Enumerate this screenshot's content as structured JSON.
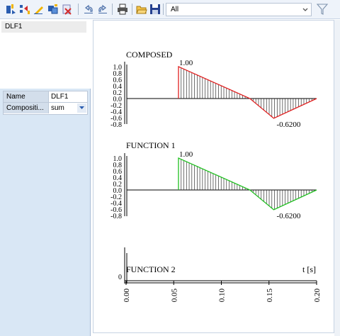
{
  "toolbar": {
    "buttons": [
      {
        "name": "new-function-icon"
      },
      {
        "name": "import-icon"
      },
      {
        "name": "edit-icon"
      },
      {
        "name": "duplicate-icon"
      },
      {
        "name": "delete-icon"
      },
      {
        "name": "undo-icon"
      },
      {
        "name": "redo-icon"
      },
      {
        "name": "print-icon"
      },
      {
        "name": "open-folder-icon"
      },
      {
        "name": "save-icon"
      }
    ],
    "filter": {
      "value": "All"
    },
    "filter_icon": "funnel-icon"
  },
  "left_panel": {
    "list_items": [
      "DLF1"
    ],
    "properties": [
      {
        "name": "Name",
        "value": "DLF1",
        "dropdown": false
      },
      {
        "name": "Compositi...",
        "value": "sum",
        "dropdown": true
      }
    ]
  },
  "colors": {
    "composed_line": "#e02020",
    "function1_line": "#20c020",
    "axis": "#000000"
  },
  "chart_data": [
    {
      "type": "line",
      "title": "COMPOSED",
      "x": [
        0.055,
        0.055,
        0.13,
        0.155,
        0.2
      ],
      "y": [
        0.0,
        1.0,
        0.0,
        -0.62,
        0.0
      ],
      "yticks": [
        "1.0",
        "0.8",
        "0.6",
        "0.4",
        "0.2",
        "0.0",
        "-0.2",
        "-0.4",
        "-0.6",
        "-0.8"
      ],
      "ylim": [
        -0.8,
        1.0
      ],
      "annotations": [
        "1.00",
        "-0.6200"
      ],
      "hatched": true
    },
    {
      "type": "line",
      "title": "FUNCTION 1",
      "x": [
        0.055,
        0.055,
        0.13,
        0.155,
        0.2
      ],
      "y": [
        0.0,
        1.0,
        0.0,
        -0.62,
        0.0
      ],
      "yticks": [
        "1.0",
        "0.8",
        "0.6",
        "0.4",
        "0.2",
        "0.0",
        "-0.2",
        "-0.4",
        "-0.6",
        "-0.8"
      ],
      "ylim": [
        -0.8,
        1.0
      ],
      "annotations": [
        "1.00",
        "-0.6200"
      ],
      "hatched": true
    },
    {
      "type": "line",
      "title": "FUNCTION 2",
      "x": [
        0.0,
        0.2
      ],
      "y": [
        0.0,
        0.0
      ],
      "yticks": [
        "0"
      ],
      "xlabel": "t [s]",
      "xticks": [
        "0.00",
        "0.05",
        "0.10",
        "0.15",
        "0.20"
      ],
      "xlim": [
        0.0,
        0.2
      ]
    }
  ]
}
